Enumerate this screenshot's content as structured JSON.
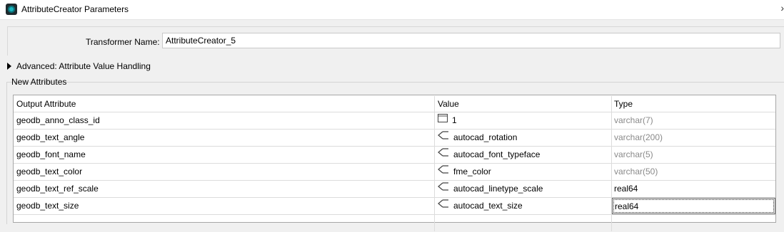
{
  "window": {
    "title": "AttributeCreator Parameters"
  },
  "transformer": {
    "label": "Transformer Name:",
    "value": "AttributeCreator_5"
  },
  "advanced": {
    "label": "Advanced: Attribute Value Handling"
  },
  "new_attributes": {
    "title": "New Attributes",
    "columns": {
      "output": "Output Attribute",
      "value": "Value",
      "type": "Type"
    },
    "rows": [
      {
        "output": "geodb_anno_class_id",
        "value_icon": "constant-value-icon",
        "value": "1",
        "type": "varchar(7)",
        "type_dim": true
      },
      {
        "output": "geodb_text_angle",
        "value_icon": "attribute-value-icon",
        "value": "autocad_rotation",
        "type": "varchar(200)",
        "type_dim": true
      },
      {
        "output": "geodb_font_name",
        "value_icon": "attribute-value-icon",
        "value": "autocad_font_typeface",
        "type": "varchar(5)",
        "type_dim": true
      },
      {
        "output": "geodb_text_color",
        "value_icon": "attribute-value-icon",
        "value": "fme_color",
        "type": "varchar(50)",
        "type_dim": true
      },
      {
        "output": "geodb_text_ref_scale",
        "value_icon": "attribute-value-icon",
        "value": "autocad_linetype_scale",
        "type": "real64",
        "type_dim": false
      },
      {
        "output": "geodb_text_size",
        "value_icon": "attribute-value-icon",
        "value": "autocad_text_size",
        "type": "real64",
        "type_dim": false
      }
    ]
  },
  "colors": {
    "dim_text": "#8a8a8a",
    "app_icon": "#19b6c0"
  }
}
